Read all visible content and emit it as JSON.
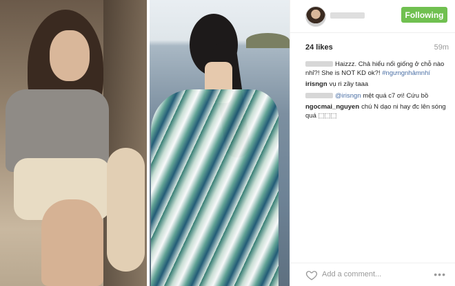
{
  "post": {
    "follow_label": "Following",
    "likes": "24 likes",
    "time_ago": "59m",
    "comments": [
      {
        "user_visible": false,
        "text": "Haizzz. Chả hiểu nổi giống ở chỗ nào nhỉ?! She is NOT KD ok?!",
        "hashtag": "#ngưngnhảmnhí"
      },
      {
        "user": "irisngn",
        "text": "vụ ri zầy taaa"
      },
      {
        "user_visible": false,
        "mention": "@irisngn",
        "text": "mệt quá c7 ơi! Cứu bồ"
      },
      {
        "user": "ngocmai_nguyen",
        "text": "chú N dạo ni hay đc lên sóng quá",
        "trail": "⬚⬚⬚"
      }
    ],
    "add_comment_placeholder": "Add a comment...",
    "more_label": "•••"
  },
  "icons": {
    "heart": "heart-icon",
    "more": "more-options-icon"
  },
  "colors": {
    "follow_button": "#70c050",
    "link": "#4a6fa5",
    "muted": "#999999"
  }
}
